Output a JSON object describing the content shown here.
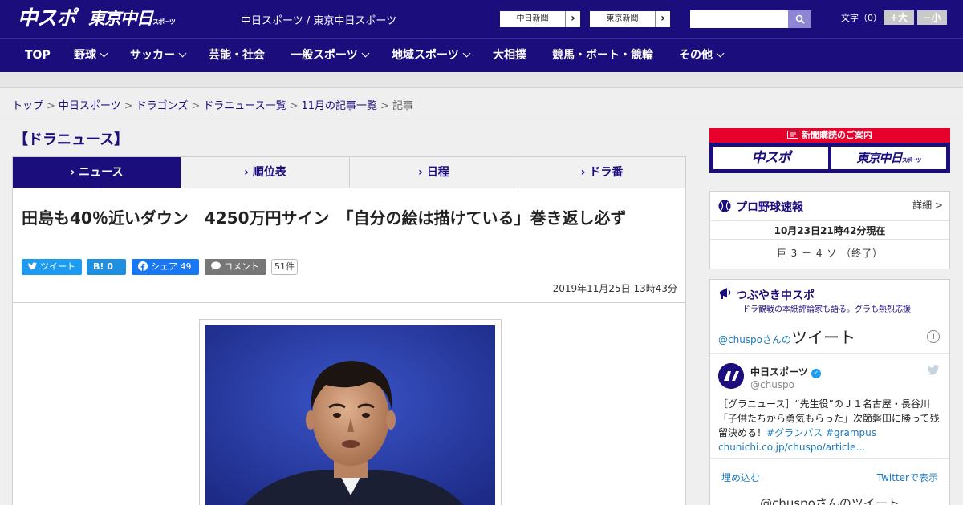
{
  "header": {
    "logo_chuspo": "中スポ",
    "logo_tokyo": "東京中日",
    "logo_tokyo_sub": "スポーツ",
    "site_names": "中日スポーツ / 東京中日スポーツ",
    "btn_chunichi": "中日新聞",
    "btn_tokyo": "東京新聞",
    "btn_arrow": "›",
    "search_placeholder": "",
    "moji": "文字（0）",
    "size_up": "+大",
    "size_down": "−小"
  },
  "nav": {
    "items": [
      {
        "label": "TOP"
      },
      {
        "label": "野球"
      },
      {
        "label": "サッカー"
      },
      {
        "label": "芸能・社会"
      },
      {
        "label": "一般スポーツ"
      },
      {
        "label": "地域スポーツ"
      },
      {
        "label": "大相撲"
      },
      {
        "label": "競馬・ボート・競輪"
      },
      {
        "label": "その他"
      }
    ]
  },
  "breadcrumb": {
    "items": [
      "トップ",
      "中日スポーツ",
      "ドラゴンズ",
      "ドラニュース一覧",
      "11月の記事一覧"
    ],
    "current": "記事",
    "sep": ">"
  },
  "section_title": "【ドラニュース】",
  "tabs": [
    {
      "label": "ニュース"
    },
    {
      "label": "順位表"
    },
    {
      "label": "日程"
    },
    {
      "label": "ドラ番"
    }
  ],
  "article": {
    "headline": "田島も40％近いダウン　4250万円サイン　「自分の絵は描けている」巻き返し必ず",
    "share_tweet": "ツイート",
    "share_hatena": "B! 0",
    "share_fb": "シェア 49",
    "share_comment": "コメント",
    "comment_count": "51件",
    "date": "2019年11月25日 13時43分"
  },
  "sidebar": {
    "subscribe_title": "新聞購読のご案内",
    "subscribe_chuspo": "中スポ",
    "subscribe_tokyo": "東京中日",
    "subscribe_tokyo_sub": "スポーツ",
    "baseball_title": "プロ野球速報",
    "baseball_detail": "詳細 >",
    "baseball_time": "10月23日21時42分現在",
    "baseball_score": "巨 3 － 4 ソ （終了）",
    "tsubuyaki_title": "つぶやき中スポ",
    "tsubuyaki_sub": "ドラ観戦の本紙評論家も語る。グラも熱烈応援",
    "tw_head_prefix": "@chuspoさんの",
    "tw_head_big": "ツイート",
    "tw_name": "中日スポーツ",
    "tw_handle": "@chuspo",
    "tw_text": "［グラニュース］“先生役”のＪ１名古屋・長谷川「子供たちから勇気もらった」次節磐田に勝って残留決める！",
    "tw_tag1": "#グランパス",
    "tw_tag2": "#grampus",
    "tw_link": "chunichi.co.jp/chuspo/article…",
    "tw_embed": "埋め込む",
    "tw_view": "Twitterで表示",
    "tw_bottom": "@chuspoさんのツイート"
  },
  "colors": {
    "brand": "#1c0d7d",
    "accent_red": "#e8002d",
    "twitter": "#1d9bf0"
  }
}
